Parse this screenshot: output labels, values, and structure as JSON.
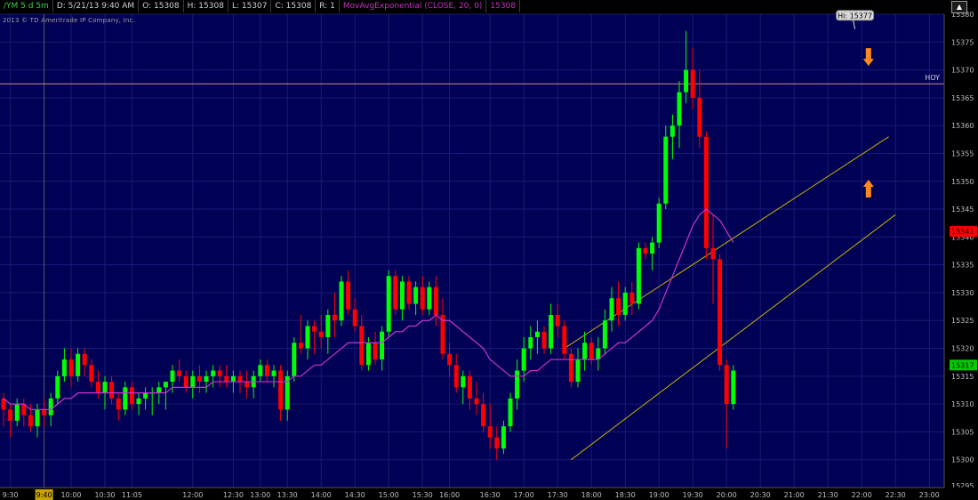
{
  "header": {
    "symbol": "/YM 5 d 5m",
    "date": "D: 5/21/13 9:40 AM",
    "open": "O: 15308",
    "high": "H: 15308",
    "low": "L: 15307",
    "close": "C: 15308",
    "range": "R: 1",
    "study": "MovAvgExponential (CLOSE, 20, 0)",
    "study_value": "15308",
    "copyright": "2013 © TD Ameritrade IP Company, Inc."
  },
  "colors": {
    "background": "#000000",
    "plot_bg": "#000055",
    "grid": "#1b1b7a",
    "up": "#00ff00",
    "down": "#ff0000",
    "ema": "#cc33cc",
    "channel": "#c9b300",
    "hoy_line": "#cc8c8c",
    "arrow": "#ff8a1a",
    "crosshair": "#5b5b5b"
  },
  "chart_data": {
    "type": "candlestick",
    "ylim": [
      15295,
      15380
    ],
    "y_ticks": [
      15300,
      15305,
      15310,
      15315,
      15320,
      15325,
      15330,
      15335,
      15340,
      15345,
      15350,
      15355,
      15360,
      15365,
      15370,
      15375,
      15380
    ],
    "y_tick_labels": [
      "15300",
      "15305",
      "15310",
      "15315",
      "15320",
      "15325",
      "15330",
      "15335",
      "15340",
      "15345",
      "15350",
      "15355",
      "15360",
      "15365",
      "15370",
      "15375",
      "15380"
    ],
    "y_clipped_label": "15295",
    "x_ticks": [
      {
        "label": "9:30",
        "bar": 1
      },
      {
        "label": "10:00",
        "bar": 10
      },
      {
        "label": "10:30",
        "bar": 15
      },
      {
        "label": "11:05",
        "bar": 19
      },
      {
        "label": "12:00",
        "bar": 28
      },
      {
        "label": "12:30",
        "bar": 34
      },
      {
        "label": "13:00",
        "bar": 38
      },
      {
        "label": "13:30",
        "bar": 42
      },
      {
        "label": "14:00",
        "bar": 47
      },
      {
        "label": "14:30",
        "bar": 52
      },
      {
        "label": "15:00",
        "bar": 57
      },
      {
        "label": "15:30",
        "bar": 62
      },
      {
        "label": "16:00",
        "bar": 66
      },
      {
        "label": "16:30",
        "bar": 72
      },
      {
        "label": "17:00",
        "bar": 77
      },
      {
        "label": "17:30",
        "bar": 82
      },
      {
        "label": "18:00",
        "bar": 87
      },
      {
        "label": "18:30",
        "bar": 92
      },
      {
        "label": "19:00",
        "bar": 97
      },
      {
        "label": "19:30",
        "bar": 102
      },
      {
        "label": "20:00",
        "bar": 107
      },
      {
        "label": "20:30",
        "bar": 112
      },
      {
        "label": "21:00",
        "bar": 117
      },
      {
        "label": "21:30",
        "bar": 122
      },
      {
        "label": "22:00",
        "bar": 127
      },
      {
        "label": "22:30",
        "bar": 132
      },
      {
        "label": "23:00",
        "bar": 137
      }
    ],
    "cursor": {
      "label": "9:40",
      "bar": 6
    },
    "bars": [
      [
        15311,
        15312,
        15306,
        15309
      ],
      [
        15309,
        15310,
        15304,
        15307
      ],
      [
        15307,
        15311,
        15306,
        15310
      ],
      [
        15310,
        15311,
        15306,
        15308
      ],
      [
        15308,
        15310,
        15305,
        15306
      ],
      [
        15306,
        15310,
        15304,
        15309
      ],
      [
        15309,
        15311,
        15306,
        15308
      ],
      [
        15308,
        15312,
        15306,
        15311
      ],
      [
        15311,
        15316,
        15310,
        15315
      ],
      [
        15315,
        15320,
        15314,
        15318
      ],
      [
        15318,
        15320,
        15313,
        15315
      ],
      [
        15315,
        15320,
        15314,
        15319
      ],
      [
        15319,
        15320,
        15315,
        15317
      ],
      [
        15317,
        15318,
        15313,
        15314
      ],
      [
        15314,
        15316,
        15311,
        15312
      ],
      [
        15312,
        15315,
        15309,
        15314
      ],
      [
        15314,
        15315,
        15310,
        15311
      ],
      [
        15311,
        15312,
        15307,
        15309
      ],
      [
        15309,
        15314,
        15308,
        15313
      ],
      [
        15313,
        15314,
        15309,
        15310
      ],
      [
        15310,
        15312,
        15308,
        15311
      ],
      [
        15311,
        15313,
        15309,
        15312
      ],
      [
        15312,
        15313,
        15308,
        15312
      ],
      [
        15312,
        15314,
        15310,
        15313
      ],
      [
        15313,
        15314,
        15309,
        15314
      ],
      [
        15314,
        15317,
        15312,
        15316
      ],
      [
        15316,
        15318,
        15314,
        15315
      ],
      [
        15315,
        15316,
        15312,
        15313
      ],
      [
        15313,
        15316,
        15311,
        15315
      ],
      [
        15315,
        15317,
        15312,
        15314
      ],
      [
        15314,
        15316,
        15312,
        15315
      ],
      [
        15315,
        15317,
        15313,
        15316
      ],
      [
        15316,
        15317,
        15313,
        15315
      ],
      [
        15315,
        15317,
        15313,
        15314
      ],
      [
        15314,
        15316,
        15312,
        15315
      ],
      [
        15315,
        15316,
        15312,
        15314
      ],
      [
        15314,
        15316,
        15311,
        15313
      ],
      [
        15313,
        15316,
        15311,
        15315
      ],
      [
        15315,
        15318,
        15314,
        15317
      ],
      [
        15317,
        15318,
        15314,
        15315
      ],
      [
        15315,
        15317,
        15313,
        15316
      ],
      [
        15316,
        15317,
        15307,
        15309
      ],
      [
        15309,
        15316,
        15307,
        15315
      ],
      [
        15315,
        15322,
        15314,
        15321
      ],
      [
        15321,
        15326,
        15319,
        15320
      ],
      [
        15320,
        15325,
        15318,
        15324
      ],
      [
        15324,
        15325,
        15319,
        15323
      ],
      [
        15323,
        15326,
        15320,
        15322
      ],
      [
        15322,
        15327,
        15319,
        15326
      ],
      [
        15326,
        15330,
        15322,
        15325
      ],
      [
        15325,
        15333,
        15324,
        15332
      ],
      [
        15332,
        15334,
        15326,
        15327
      ],
      [
        15327,
        15329,
        15323,
        15324
      ],
      [
        15324,
        15326,
        15316,
        15317
      ],
      [
        15317,
        15322,
        15316,
        15321
      ],
      [
        15321,
        15323,
        15317,
        15318
      ],
      [
        15318,
        15324,
        15316,
        15323
      ],
      [
        15323,
        15334,
        15322,
        15333
      ],
      [
        15333,
        15334,
        15326,
        15327
      ],
      [
        15327,
        15333,
        15325,
        15332
      ],
      [
        15332,
        15333,
        15327,
        15328
      ],
      [
        15328,
        15332,
        15326,
        15331
      ],
      [
        15331,
        15333,
        15326,
        15327
      ],
      [
        15327,
        15332,
        15326,
        15331
      ],
      [
        15331,
        15333,
        15324,
        15326
      ],
      [
        15326,
        15329,
        15318,
        15319
      ],
      [
        15319,
        15321,
        15315,
        15317
      ],
      [
        15317,
        15319,
        15312,
        15313
      ],
      [
        15313,
        15316,
        15310,
        15315
      ],
      [
        15315,
        15316,
        15309,
        15311
      ],
      [
        15311,
        15314,
        15308,
        15310
      ],
      [
        15310,
        15312,
        15305,
        15306
      ],
      [
        15306,
        15310,
        15302,
        15304
      ],
      [
        15304,
        15306,
        15300,
        15302
      ],
      [
        15302,
        15307,
        15301,
        15306
      ],
      [
        15306,
        15312,
        15305,
        15311
      ],
      [
        15311,
        15318,
        15309,
        15316
      ],
      [
        15316,
        15322,
        15314,
        15320
      ],
      [
        15320,
        15324,
        15318,
        15322
      ],
      [
        15322,
        15325,
        15319,
        15323
      ],
      [
        15323,
        15324,
        15319,
        15320
      ],
      [
        15320,
        15328,
        15319,
        15326
      ],
      [
        15326,
        15328,
        15322,
        15324
      ],
      [
        15324,
        15325,
        15318,
        15319
      ],
      [
        15319,
        15320,
        15313,
        15314
      ],
      [
        15314,
        15320,
        15313,
        15318
      ],
      [
        15318,
        15323,
        15316,
        15321
      ],
      [
        15321,
        15322,
        15317,
        15318
      ],
      [
        15318,
        15322,
        15316,
        15320
      ],
      [
        15320,
        15327,
        15319,
        15325
      ],
      [
        15325,
        15331,
        15323,
        15329
      ],
      [
        15329,
        15332,
        15324,
        15326
      ],
      [
        15326,
        15331,
        15325,
        15330
      ],
      [
        15330,
        15332,
        15326,
        15328
      ],
      [
        15328,
        15339,
        15327,
        15338
      ],
      [
        15338,
        15339,
        15336,
        15337
      ],
      [
        15337,
        15340,
        15334,
        15339
      ],
      [
        15339,
        15347,
        15338,
        15346
      ],
      [
        15346,
        15360,
        15345,
        15358
      ],
      [
        15358,
        15362,
        15354,
        15360
      ],
      [
        15360,
        15368,
        15356,
        15366
      ],
      [
        15366,
        15377,
        15364,
        15370
      ],
      [
        15370,
        15374,
        15363,
        15365
      ],
      [
        15365,
        15370,
        15356,
        15358
      ],
      [
        15358,
        15359,
        15336,
        15338
      ],
      [
        15338,
        15344,
        15328,
        15336
      ],
      [
        15336,
        15337,
        15316,
        15317
      ],
      [
        15317,
        15318,
        15302,
        15310
      ],
      [
        15310,
        15317,
        15309,
        15316
      ]
    ],
    "ema": [
      15311,
      15310,
      15310,
      15310,
      15309,
      15309,
      15309,
      15309,
      15310,
      15311,
      15311,
      15312,
      15312,
      15312,
      15312,
      15312,
      15312,
      15312,
      15312,
      15312,
      15312,
      15312,
      15312,
      15312,
      15312,
      15313,
      15313,
      15313,
      15313,
      15313,
      15313,
      15314,
      15314,
      15314,
      15314,
      15314,
      15314,
      15314,
      15314,
      15314,
      15314,
      15314,
      15314,
      15315,
      15315,
      15316,
      15317,
      15317,
      15318,
      15319,
      15320,
      15321,
      15321,
      15321,
      15321,
      15321,
      15321,
      15322,
      15323,
      15323,
      15324,
      15324,
      15325,
      15325,
      15326,
      15325,
      15325,
      15324,
      15323,
      15322,
      15321,
      15320,
      15318,
      15317,
      15316,
      15315,
      15315,
      15315,
      15316,
      15316,
      15317,
      15318,
      15318,
      15318,
      15318,
      15318,
      15318,
      15318,
      15318,
      15319,
      15320,
      15321,
      15321,
      15322,
      15323,
      15324,
      15325,
      15327,
      15330,
      15333,
      15336,
      15339,
      15342,
      15344,
      15345,
      15344,
      15343,
      15341,
      15339
    ],
    "channel_upper": {
      "x": [
        83,
        131
      ],
      "y": [
        15320,
        15358
      ]
    },
    "channel_lower": {
      "x": [
        84,
        132
      ],
      "y": [
        15300,
        15344
      ]
    },
    "hoy_level": 15367.5,
    "hoy_label": "HOY",
    "high_marker": {
      "label": "Hi: 15377",
      "bar": 126,
      "value": 15377
    },
    "arrows": [
      {
        "direction": "down",
        "bar": 128,
        "value": 15372
      },
      {
        "direction": "up",
        "bar": 128,
        "value": 15349
      }
    ],
    "price_tags": [
      {
        "label": "15341",
        "value": 15341,
        "color": "#ff0000"
      },
      {
        "label": "15317",
        "value": 15317,
        "color": "#00cc00"
      }
    ]
  }
}
